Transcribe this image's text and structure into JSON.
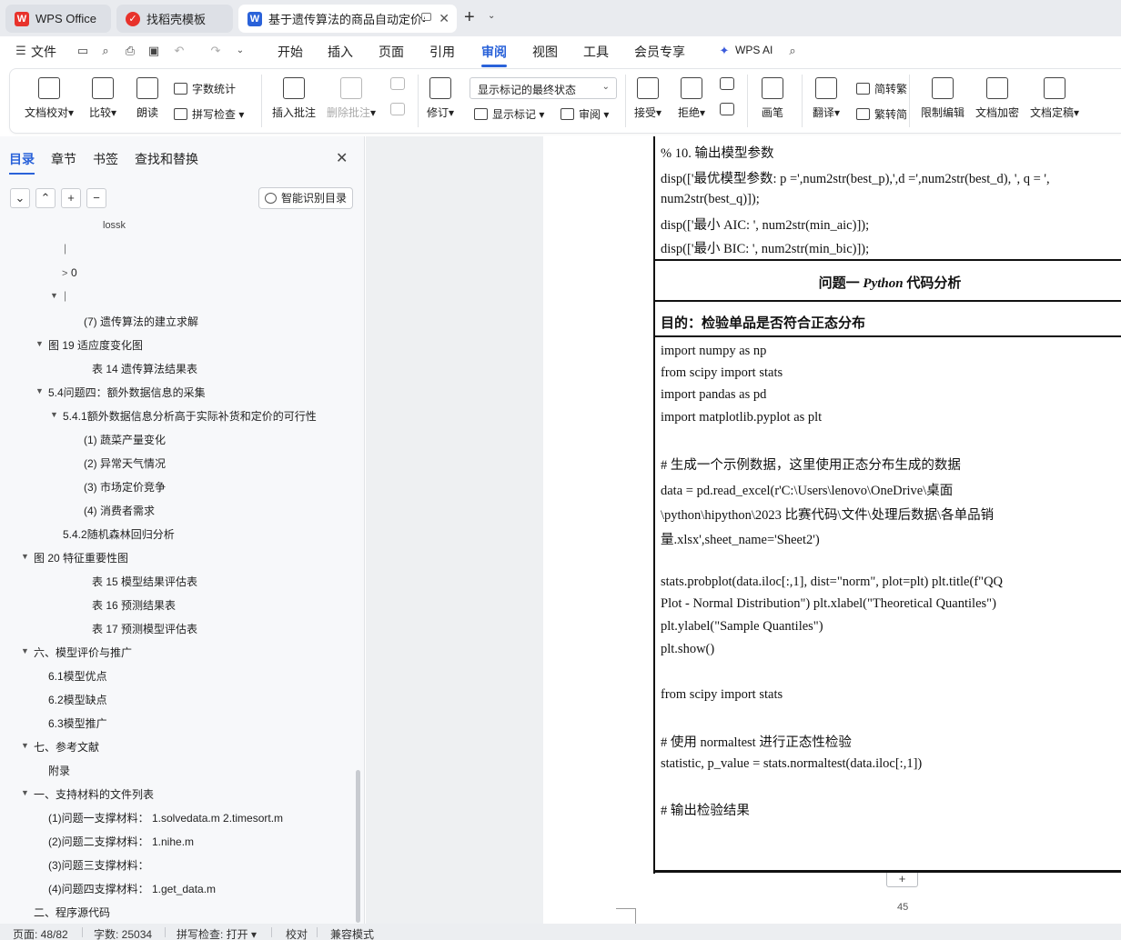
{
  "tabs": [
    {
      "label": "WPS Office",
      "icon": "wps-logo-icon",
      "color": "#e8322b"
    },
    {
      "label": "找稻壳模板",
      "icon": "docer-icon",
      "color": "#e8322b"
    },
    {
      "label": "基于遗传算法的商品自动定价与",
      "icon": "word-doc-icon",
      "color": "#2a62d9"
    }
  ],
  "menu": {
    "file": "文件",
    "items": [
      "开始",
      "插入",
      "页面",
      "引用",
      "审阅",
      "视图",
      "工具",
      "会员专享"
    ],
    "active": "审阅",
    "wps_ai": "WPS AI"
  },
  "ribbon": {
    "doc_check": "文档校对",
    "compare": "比较",
    "read_aloud": "朗读",
    "word_count": "字数统计",
    "spell_check": "拼写检查",
    "insert_comment": "插入批注",
    "delete_comment": "删除批注",
    "track_changes": "修订",
    "show_markup_select": "显示标记的最终状态",
    "show_markup": "显示标记",
    "review": "审阅",
    "accept": "接受",
    "reject": "拒绝",
    "pen": "画笔",
    "translate": "翻译",
    "simp_to_trad": "简转繁",
    "trad_to_simp": "繁转简",
    "restrict_edit": "限制编辑",
    "encrypt": "文档加密",
    "finalize": "文档定稿"
  },
  "nav": {
    "tabs": [
      "目录",
      "章节",
      "书签",
      "查找和替换"
    ],
    "active": "目录",
    "smart_toc": "智能识别目录",
    "items": [
      {
        "text": "lossk",
        "expander": ""
      },
      {
        "text": "|",
        "expander": ""
      },
      {
        "text": "0",
        "expander": ">"
      },
      {
        "text": "|",
        "expander": "▼"
      },
      {
        "text": "(7) 遗传算法的建立求解",
        "expander": ""
      },
      {
        "text": "图 19 适应度变化图",
        "expander": "▼"
      },
      {
        "text": "表 14 遗传算法结果表",
        "expander": ""
      },
      {
        "text": "5.4问题四：额外数据信息的采集",
        "expander": "▼"
      },
      {
        "text": "5.4.1额外数据信息分析高于实际补货和定价的可行性",
        "expander": "▼"
      },
      {
        "text": "(1) 蔬菜产量变化",
        "expander": ""
      },
      {
        "text": "(2) 异常天气情况",
        "expander": ""
      },
      {
        "text": "(3) 市场定价竞争",
        "expander": ""
      },
      {
        "text": "(4) 消费者需求",
        "expander": ""
      },
      {
        "text": "5.4.2随机森林回归分析",
        "expander": ""
      },
      {
        "text": "图 20 特征重要性图",
        "expander": "▼"
      },
      {
        "text": "表 15 模型结果评估表",
        "expander": ""
      },
      {
        "text": "表 16 预测结果表",
        "expander": ""
      },
      {
        "text": "表 17 预测模型评估表",
        "expander": ""
      },
      {
        "text": "六、模型评价与推广",
        "expander": "▼"
      },
      {
        "text": "6.1模型优点",
        "expander": ""
      },
      {
        "text": "6.2模型缺点",
        "expander": ""
      },
      {
        "text": "6.3模型推广",
        "expander": ""
      },
      {
        "text": "七、参考文献",
        "expander": "▼"
      },
      {
        "text": "附录",
        "expander": ""
      },
      {
        "text": "一、支持材料的文件列表",
        "expander": "▼"
      },
      {
        "text": "(1)问题一支撑材料： 1.solvedata.m 2.timesort.m",
        "expander": ""
      },
      {
        "text": "(2)问题二支撑材料： 1.nihe.m",
        "expander": ""
      },
      {
        "text": "(3)问题三支撑材料：",
        "expander": ""
      },
      {
        "text": "(4)问题四支撑材料： 1.get_data.m",
        "expander": ""
      },
      {
        "text": "二、程序源代码",
        "expander": ""
      }
    ]
  },
  "document": {
    "top_lines": [
      "% 10. 输出模型参数",
      "disp(['最优模型参数: p =',num2str(best_p),',d =',num2str(best_d), ', q = ',",
      "num2str(best_q)]);",
      "disp(['最小 AIC: ', num2str(min_aic)]);",
      "disp(['最小 BIC: ', num2str(min_bic)]);"
    ],
    "table_heading_pre": "问题一 ",
    "table_heading_em": "Python",
    "table_heading_post": " 代码分析",
    "purpose": "目的：检验单品是否符合正态分布",
    "code_lines": [
      "import numpy as np",
      "from scipy import stats",
      "import pandas as pd",
      "import matplotlib.pyplot as plt",
      "# 生成一个示例数据，这里使用正态分布生成的数据",
      "data = pd.read_excel(r'C:\\Users\\lenovo\\OneDrive\\桌面",
      "\\python\\hipython\\2023 比赛代码\\文件\\处理后数据\\各单品销",
      "量.xlsx',sheet_name='Sheet2')",
      "stats.probplot(data.iloc[:,1], dist=\"norm\", plot=plt) plt.title(f\"QQ",
      "Plot - Normal Distribution\") plt.xlabel(\"Theoretical Quantiles\")",
      "plt.ylabel(\"Sample Quantiles\")",
      "plt.show()",
      "from scipy import stats",
      "# 使用 normaltest 进行正态性检验",
      "statistic, p_value = stats.normaltest(data.iloc[:,1])",
      "# 输出检验结果"
    ],
    "add_row": "+",
    "page_number": "45"
  },
  "status": {
    "page": "页面: 48/82",
    "words": "字数: 25034",
    "spell": "拼写检查: 打开",
    "proof": "校对",
    "compat": "兼容模式"
  },
  "colors": {
    "accent": "#2a62d9",
    "wps_red": "#e8322b"
  }
}
